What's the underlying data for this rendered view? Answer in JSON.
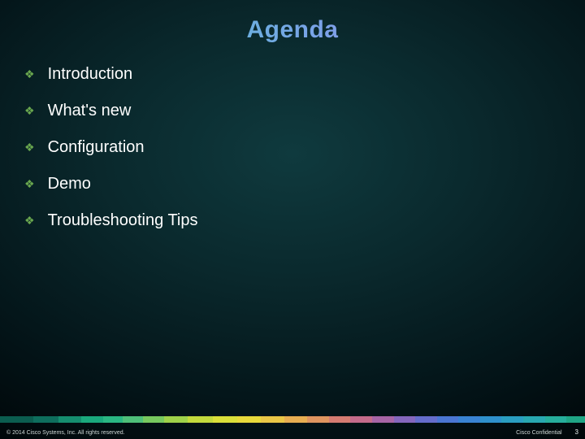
{
  "title": "Agenda",
  "items": [
    "Introduction",
    "What's new",
    "Configuration",
    "Demo",
    "Troubleshooting Tips"
  ],
  "footer": {
    "copyright": "© 2014 Cisco Systems, Inc. All rights reserved.",
    "confidential": "Cisco Confidential",
    "page": "3"
  },
  "colorbar": [
    {
      "c": "#0b5d4f",
      "w": 40
    },
    {
      "c": "#0e6e5d",
      "w": 30
    },
    {
      "c": "#158e6f",
      "w": 28
    },
    {
      "c": "#1aa97d",
      "w": 26
    },
    {
      "c": "#2ab783",
      "w": 24
    },
    {
      "c": "#4ec07a",
      "w": 24
    },
    {
      "c": "#77c95f",
      "w": 26
    },
    {
      "c": "#9fd24a",
      "w": 28
    },
    {
      "c": "#c3da3d",
      "w": 30
    },
    {
      "c": "#dbe03a",
      "w": 30
    },
    {
      "c": "#e8da3c",
      "w": 28
    },
    {
      "c": "#eac747",
      "w": 28
    },
    {
      "c": "#e7ae52",
      "w": 28
    },
    {
      "c": "#df9560",
      "w": 26
    },
    {
      "c": "#d57c72",
      "w": 26
    },
    {
      "c": "#c46b8b",
      "w": 26
    },
    {
      "c": "#a765a6",
      "w": 26
    },
    {
      "c": "#8567bd",
      "w": 26
    },
    {
      "c": "#656dcc",
      "w": 26
    },
    {
      "c": "#4a76d3",
      "w": 26
    },
    {
      "c": "#3983d3",
      "w": 26
    },
    {
      "c": "#2f91cc",
      "w": 26
    },
    {
      "c": "#2a9ec1",
      "w": 26
    },
    {
      "c": "#28a8b1",
      "w": 26
    },
    {
      "c": "#26ae9c",
      "w": 26
    },
    {
      "c": "#1fa585",
      "w": 22
    }
  ]
}
